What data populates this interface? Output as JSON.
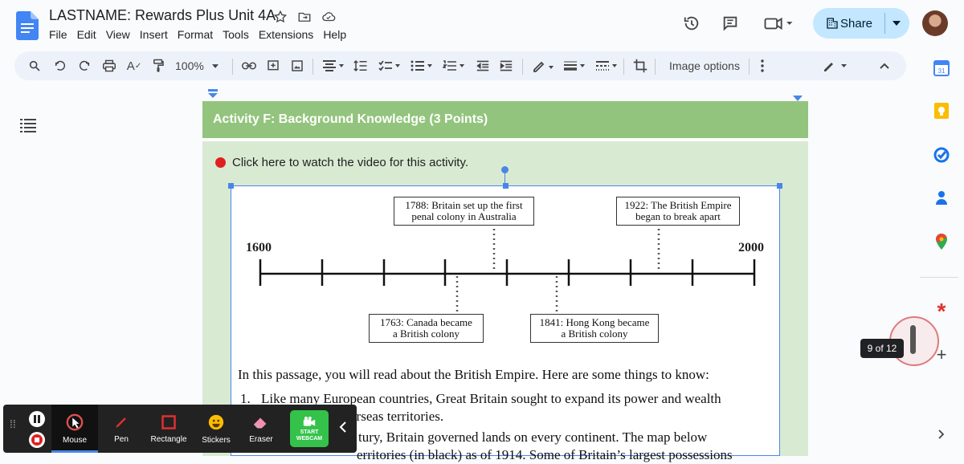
{
  "header": {
    "title": "LASTNAME: Rewards Plus Unit 4A",
    "menu": [
      "File",
      "Edit",
      "View",
      "Insert",
      "Format",
      "Tools",
      "Extensions",
      "Help"
    ],
    "share_label": "Share"
  },
  "toolbar": {
    "zoom": "100%",
    "image_options_label": "Image options"
  },
  "document": {
    "activity_heading": "Activity F: Background Knowledge (3 Points)",
    "video_link_text": "Click here to watch the video for this activity.",
    "timeline": {
      "start_label": "1600",
      "end_label": "2000",
      "events": [
        {
          "text": "1788: Britain set up the first penal colony in Australia",
          "line1": "1788: Britain set up the first",
          "line2": "penal colony in Australia"
        },
        {
          "text": "1922: The British Empire began to break apart",
          "line1": "1922: The British Empire",
          "line2": "began to break apart"
        },
        {
          "text": "1763: Canada became a British colony",
          "line1": "1763: Canada became",
          "line2": "a British colony"
        },
        {
          "text": "1841: Hong Kong became a British colony",
          "line1": "1841: Hong Kong became",
          "line2": "a British colony"
        }
      ]
    },
    "passage_intro": "In this passage, you will read about the British Empire. Here are some things to know:",
    "item1_number": "1.",
    "item1_line1": "Like many European countries, Great Britain sought to expand its power and wealth",
    "item1_line2_visible": "erseas territories.",
    "item2_line1_visible": "tury, Britain governed lands on every continent. The map below",
    "item2_line2_visible": "erritories (in black) as of 1914. Some of Britain’s largest possessions"
  },
  "page_counter": "9 of 12",
  "recorder": {
    "buttons": [
      {
        "label": "Mouse"
      },
      {
        "label": "Pen"
      },
      {
        "label": "Rectangle"
      },
      {
        "label": "Stickers"
      },
      {
        "label": "Eraser"
      }
    ],
    "webcam_line1": "START",
    "webcam_line2": "WEBCAM"
  },
  "colors": {
    "share_bg": "#c2e7ff",
    "heading_green": "#93c47d",
    "light_green": "#d9ead3",
    "selection_blue": "#4a86e8",
    "record_red": "#e02020"
  }
}
